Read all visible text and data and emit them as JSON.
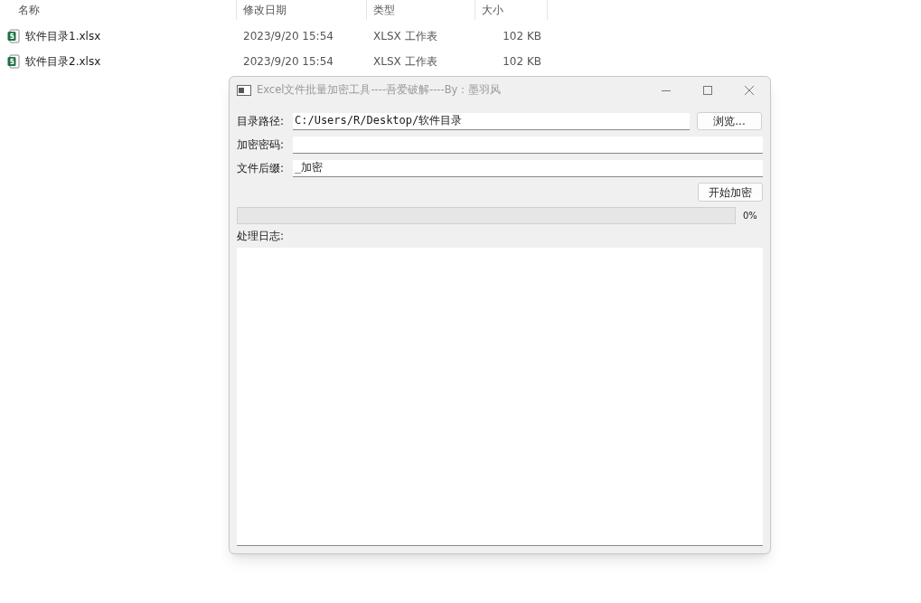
{
  "file_list": {
    "columns": [
      "名称",
      "修改日期",
      "类型",
      "大小"
    ],
    "rows": [
      {
        "name": "软件目录1.xlsx",
        "modified": "2023/9/20 15:54",
        "type": "XLSX 工作表",
        "size": "102 KB"
      },
      {
        "name": "软件目录2.xlsx",
        "modified": "2023/9/20 15:54",
        "type": "XLSX 工作表",
        "size": "102 KB"
      }
    ]
  },
  "dialog": {
    "title": "Excel文件批量加密工具----吾爱破解----By：墨羽风",
    "active": false,
    "fields": [
      {
        "label": "目录路径:",
        "value": "C:/Users/R/Desktop/软件目录"
      },
      {
        "label": "加密密码:"
      },
      {
        "label": "文件后缀:",
        "value": "_加密"
      }
    ],
    "browse_button": "浏览...",
    "start_button": "开始加密",
    "progress": {
      "level": 0,
      "reading": "0%"
    },
    "log_label": "处理日志:"
  }
}
